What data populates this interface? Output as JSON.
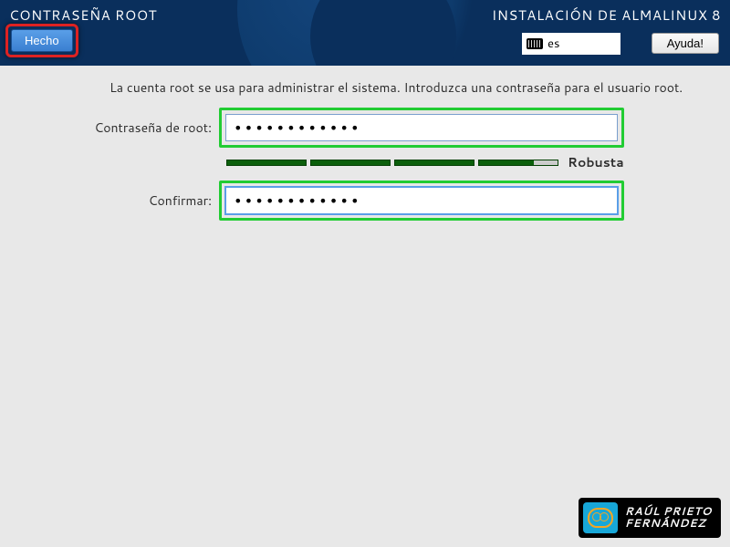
{
  "header": {
    "page_title": "CONTRASEÑA ROOT",
    "install_title": "INSTALACIÓN DE ALMALINUX 8",
    "done_label": "Hecho",
    "help_label": "Ayuda!",
    "kbd_layout": "es"
  },
  "main": {
    "intro": "La cuenta root se usa para administrar el sistema. Introduzca una contraseña para el usuario root.",
    "password_label": "Contraseña de root:",
    "confirm_label": "Confirmar:",
    "password_value": "••••••••••••",
    "confirm_value": "••••••••••••",
    "strength_label": "Robusta"
  },
  "watermark": {
    "line1": "RAÚL PRIETO",
    "line2": "FERNÁNDEZ"
  }
}
